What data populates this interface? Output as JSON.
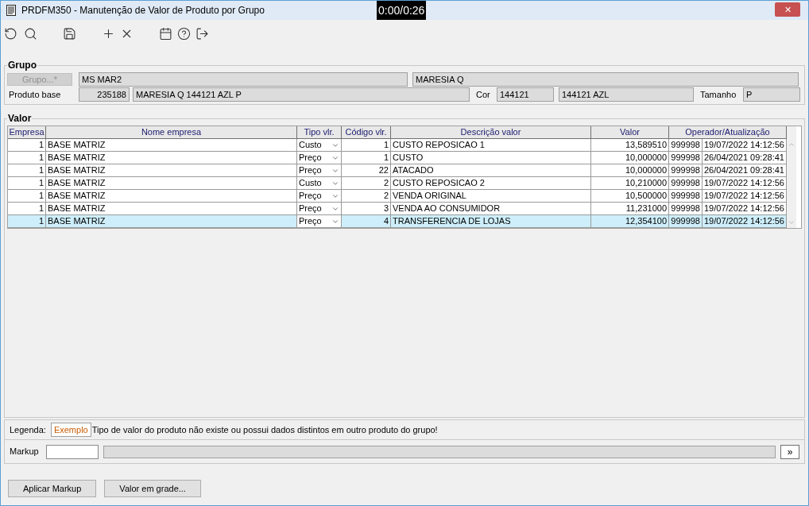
{
  "window": {
    "title": "PRDFM350 - Manutenção de Valor de Produto por Grupo",
    "close": "✕"
  },
  "video_time": "0:00/0:26",
  "grupo": {
    "legend": "Grupo",
    "button": "Grupo...*",
    "button_disabled": true,
    "code": "MS MAR2",
    "name": "MARESIA Q",
    "produto_label": "Produto base",
    "produto_code": "235188",
    "produto_name": "MARESIA Q 144121 AZL P",
    "cor_label": "Cor",
    "cor_code": "144121",
    "cor_name": "144121 AZL",
    "tamanho_label": "Tamanho",
    "tamanho": "P"
  },
  "valor": {
    "legend": "Valor",
    "columns": [
      "Empresa",
      "Nome empresa",
      "Tipo vlr.",
      "Código vlr.",
      "Descrição valor",
      "Valor",
      "Operador/Atualização"
    ],
    "rows": [
      {
        "empresa": "1",
        "nome": "BASE MATRIZ",
        "tipo": "Custo",
        "codigo": "1",
        "descricao": "CUSTO REPOSICAO 1",
        "valor": "13,589510",
        "operador": "999998",
        "data": "19/07/2022 14:12:56",
        "selected": false
      },
      {
        "empresa": "1",
        "nome": "BASE MATRIZ",
        "tipo": "Preço",
        "codigo": "1",
        "descricao": "CUSTO",
        "valor": "10,000000",
        "operador": "999998",
        "data": "26/04/2021 09:28:41",
        "selected": false
      },
      {
        "empresa": "1",
        "nome": "BASE MATRIZ",
        "tipo": "Preço",
        "codigo": "22",
        "descricao": "ATACADO",
        "valor": "10,000000",
        "operador": "999998",
        "data": "26/04/2021 09:28:41",
        "selected": false
      },
      {
        "empresa": "1",
        "nome": "BASE MATRIZ",
        "tipo": "Custo",
        "codigo": "2",
        "descricao": "CUSTO REPOSICAO 2",
        "valor": "10,210000",
        "operador": "999998",
        "data": "19/07/2022 14:12:56",
        "selected": false
      },
      {
        "empresa": "1",
        "nome": "BASE MATRIZ",
        "tipo": "Preço",
        "codigo": "2",
        "descricao": "VENDA ORIGINAL",
        "valor": "10,500000",
        "operador": "999998",
        "data": "19/07/2022 14:12:56",
        "selected": false
      },
      {
        "empresa": "1",
        "nome": "BASE MATRIZ",
        "tipo": "Preço",
        "codigo": "3",
        "descricao": "VENDA AO CONSUMIDOR",
        "valor": "11,231000",
        "operador": "999998",
        "data": "19/07/2022 14:12:56",
        "selected": false
      },
      {
        "empresa": "1",
        "nome": "BASE MATRIZ",
        "tipo": "Preço",
        "codigo": "4",
        "descricao": "TRANSFERENCIA DE LOJAS",
        "valor": "12,354100",
        "operador": "999998",
        "data": "19/07/2022 14:12:56",
        "selected": true
      }
    ]
  },
  "legenda": {
    "label": "Legenda:",
    "example": "Exemplo",
    "text": "Tipo de valor do produto não existe ou possui dados distintos em outro produto do grupo!"
  },
  "markup": {
    "label": "Markup",
    "next": "»"
  },
  "buttons": [
    "Aplicar Markup",
    "Valor em grade..."
  ]
}
